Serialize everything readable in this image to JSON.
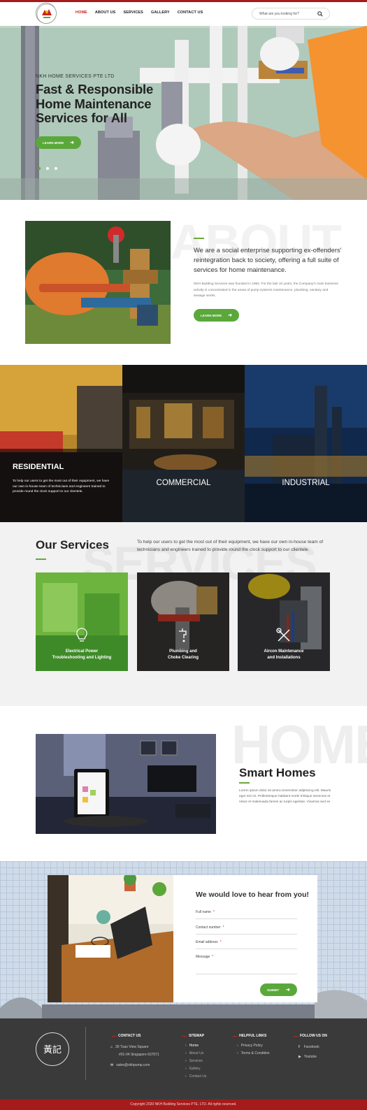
{
  "header": {
    "nav": [
      "HOME",
      "ABOUT US",
      "SERVICES",
      "GALLERY",
      "CONTACT US"
    ],
    "search_placeholder": "What are you looking for?"
  },
  "hero": {
    "subtitle": "NKH HOME SERVICES PTE LTD",
    "title_line1": "Fast & Responsible",
    "title_line2": "Home Maintenance",
    "title_line3": "Services for All",
    "button": "LEARN MORE"
  },
  "about": {
    "bg_word": "ABOUT",
    "heading": "We are a social enterprise supporting ex-offenders' reintegration back to society, offering a full suite of services for home maintenance.",
    "body": "NKH Building Services was founded in 1982. For the last 10 years, the Company's main business activity is concentrated in the areas of pump systems maintenance, plumbing, sanitary and sewage works.",
    "button": "LEARN MORE"
  },
  "categories": {
    "residential": {
      "title": "RESIDENTIAL",
      "text": "To help our users to get the most out of their equipment, we have our own in-house team of technicians and engineers trained to provide round the clock support to our clientele."
    },
    "commercial": "COMMERCIAL",
    "industrial": "INDUSTRIAL"
  },
  "services": {
    "bg_word": "SERVICES",
    "title": "Our Services",
    "intro": "To help our users to get the most out of their equipment, we have our own in-house team of technicians and engineers trained to provide round the clock support to our clientele.",
    "cards": [
      {
        "line1": "Electrical Power",
        "line2": "Troubleshooting and Lighting",
        "icon": "lightbulb-icon"
      },
      {
        "line1": "Plumbing and",
        "line2": "Choke Clearing",
        "icon": "faucet-icon"
      },
      {
        "line1": "Aircon Maintenance",
        "line2": "and Installations",
        "icon": "tools-icon"
      }
    ]
  },
  "smart": {
    "bg_word": "HOME",
    "title": "Smart Homes",
    "body": "Lorem ipsum dolor sit amet,consectetur adipiscing elit. Mauris eget nisi mi. Pellentesque habitant morbi tristique senectus et netus et malesuada fames ac turpis egestas. Vivamus sed ex"
  },
  "contact_form": {
    "title": "We would love to hear from you!",
    "fields": [
      "Full name",
      "Contact number",
      "Email address",
      "Message"
    ],
    "submit": "SUBMIT"
  },
  "footer": {
    "contact_heading": "CONTACT US",
    "address_line1": "30 Tuas View Square",
    "address_line2": "#01-04 Singapore 637071",
    "email": "sales@nkhpump.com",
    "sitemap_heading": "SITEMAP",
    "sitemap": [
      "Home",
      "About Us",
      "Services",
      "Gallery",
      "Contact Us"
    ],
    "helpful_heading": "HELPFUL LINKS",
    "helpful": [
      "Privacy Policy",
      "Terms & Condition"
    ],
    "follow_heading": "FOLLOW US ON",
    "social": [
      "Facebook",
      "Youtube"
    ],
    "copyright": "Copyright 2020 NKH Building Services PTE. LTD. All rights reserved.",
    "logo_text": "黃記"
  },
  "colors": {
    "brand_red": "#a51b1b",
    "accent_green": "#5aa83a",
    "footer_bg": "#3a3a3a"
  }
}
